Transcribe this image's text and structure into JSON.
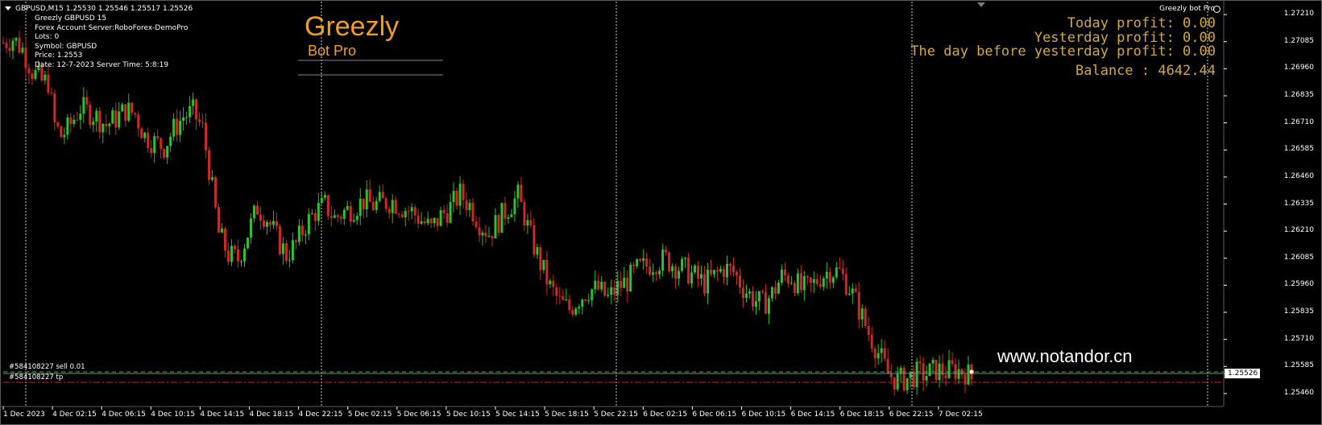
{
  "window": {
    "symbol_line": "GBPUSD,M15  1.25530 1.25546 1.25517 1.25526",
    "indicator_short_name": "Greezly bot Pro"
  },
  "info_panel": [
    "Greezly  GBPUSD  15",
    "Forex Account Server:RoboForex-DemoPro",
    "Lots:  0",
    "Symbol: GBPUSD",
    "Price:  1.2553",
    "Date: 12-7-2023 Server Time: 5:8:19"
  ],
  "logo": {
    "title": "Greezly",
    "subtitle": "Bot Pro"
  },
  "profits": {
    "today": "Today profit: 0.00",
    "yesterday": "Yesterday profit: 0.00",
    "day_before": "The day before yesterday profit: 0.00",
    "balance": "Balance : 4642.44"
  },
  "watermark": "www.notandor.cn",
  "trades": {
    "sell": "#584108227 sell 0.01",
    "tp": "#584108227 tp"
  },
  "price_axis": {
    "labels": [
      "1.27210",
      "1.27085",
      "1.26960",
      "1.26835",
      "1.26710",
      "1.26585",
      "1.26460",
      "1.26335",
      "1.26210",
      "1.26085",
      "1.25960",
      "1.25835",
      "1.25710",
      "1.25585",
      "1.25460"
    ],
    "current_price": "1.25526"
  },
  "time_axis": [
    "1 Dec 2023",
    "4 Dec 02:15",
    "4 Dec 06:15",
    "4 Dec 10:15",
    "4 Dec 14:15",
    "4 Dec 18:15",
    "4 Dec 22:15",
    "5 Dec 02:15",
    "5 Dec 06:15",
    "5 Dec 10:15",
    "5 Dec 14:15",
    "5 Dec 18:15",
    "5 Dec 22:15",
    "6 Dec 02:15",
    "6 Dec 06:15",
    "6 Dec 10:15",
    "6 Dec 14:15",
    "6 Dec 18:15",
    "6 Dec 22:15",
    "7 Dec 02:15"
  ],
  "colors": {
    "bull": "#2ec02e",
    "bear": "#cc2a2a",
    "profit_text": "#d4a844",
    "logo": "#f0a020",
    "grid": "#d0d0d0",
    "axis_text": "#ffffff"
  },
  "chart_data": {
    "type": "candlestick",
    "symbol": "GBPUSD",
    "timeframe": "M15",
    "ylim": [
      1.254,
      1.2727
    ],
    "path": [
      [
        0,
        1.2708
      ],
      [
        3,
        1.271
      ],
      [
        6,
        1.2705
      ],
      [
        9,
        1.2695
      ],
      [
        12,
        1.269
      ],
      [
        14,
        1.269
      ],
      [
        16,
        1.267
      ],
      [
        18,
        1.2665
      ],
      [
        20,
        1.2668
      ],
      [
        24,
        1.2678
      ],
      [
        28,
        1.2675
      ],
      [
        32,
        1.267
      ],
      [
        35,
        1.2673
      ],
      [
        38,
        1.2677
      ],
      [
        41,
        1.2675
      ],
      [
        44,
        1.2665
      ],
      [
        47,
        1.2662
      ],
      [
        50,
        1.266
      ],
      [
        53,
        1.2668
      ],
      [
        56,
        1.2674
      ],
      [
        59,
        1.2676
      ],
      [
        62,
        1.2668
      ],
      [
        64,
        1.265
      ],
      [
        67,
        1.262
      ],
      [
        70,
        1.261
      ],
      [
        73,
        1.2608
      ],
      [
        76,
        1.262
      ],
      [
        79,
        1.2632
      ],
      [
        82,
        1.2627
      ],
      [
        85,
        1.2618
      ],
      [
        88,
        1.261
      ],
      [
        91,
        1.2615
      ],
      [
        94,
        1.2624
      ],
      [
        97,
        1.263
      ],
      [
        100,
        1.2633
      ],
      [
        103,
        1.2627
      ],
      [
        106,
        1.263
      ],
      [
        109,
        1.2632
      ],
      [
        112,
        1.2635
      ],
      [
        115,
        1.2633
      ],
      [
        118,
        1.2634
      ],
      [
        121,
        1.2635
      ],
      [
        124,
        1.2632
      ],
      [
        127,
        1.263
      ],
      [
        130,
        1.2626
      ],
      [
        133,
        1.2622
      ],
      [
        136,
        1.2628
      ],
      [
        139,
        1.2632
      ],
      [
        142,
        1.2638
      ],
      [
        145,
        1.2633
      ],
      [
        148,
        1.2625
      ],
      [
        151,
        1.262
      ],
      [
        154,
        1.2626
      ],
      [
        157,
        1.2632
      ],
      [
        160,
        1.2637
      ],
      [
        162,
        1.2628
      ],
      [
        164,
        1.2618
      ],
      [
        167,
        1.2606
      ],
      [
        170,
        1.2595
      ],
      [
        173,
        1.2588
      ],
      [
        176,
        1.2585
      ],
      [
        179,
        1.259
      ],
      [
        182,
        1.2594
      ],
      [
        185,
        1.2594
      ],
      [
        188,
        1.259
      ],
      [
        191,
        1.2595
      ],
      [
        194,
        1.2598
      ],
      [
        197,
        1.2603
      ],
      [
        200,
        1.2605
      ],
      [
        203,
        1.2607
      ],
      [
        206,
        1.2608
      ],
      [
        209,
        1.2605
      ],
      [
        212,
        1.2603
      ],
      [
        215,
        1.26
      ],
      [
        218,
        1.2597
      ],
      [
        221,
        1.26
      ],
      [
        224,
        1.2604
      ],
      [
        227,
        1.2602
      ],
      [
        230,
        1.2595
      ],
      [
        233,
        1.259
      ],
      [
        236,
        1.2587
      ],
      [
        239,
        1.2592
      ],
      [
        242,
        1.26
      ],
      [
        245,
        1.26
      ],
      [
        248,
        1.2594
      ],
      [
        251,
        1.2595
      ],
      [
        254,
        1.26
      ],
      [
        257,
        1.2603
      ],
      [
        260,
        1.2602
      ],
      [
        263,
        1.2595
      ],
      [
        266,
        1.2585
      ],
      [
        269,
        1.2574
      ],
      [
        272,
        1.2565
      ],
      [
        275,
        1.2555
      ],
      [
        278,
        1.2552
      ],
      [
        281,
        1.2553
      ],
      [
        284,
        1.2555
      ],
      [
        287,
        1.2555
      ],
      [
        290,
        1.2557
      ],
      [
        293,
        1.2556
      ],
      [
        296,
        1.2557
      ],
      [
        299,
        1.2556
      ],
      [
        301,
        1.2553
      ]
    ],
    "last_price": 1.25526,
    "sell_order_price": 1.2554,
    "tp_price": 1.2546
  }
}
